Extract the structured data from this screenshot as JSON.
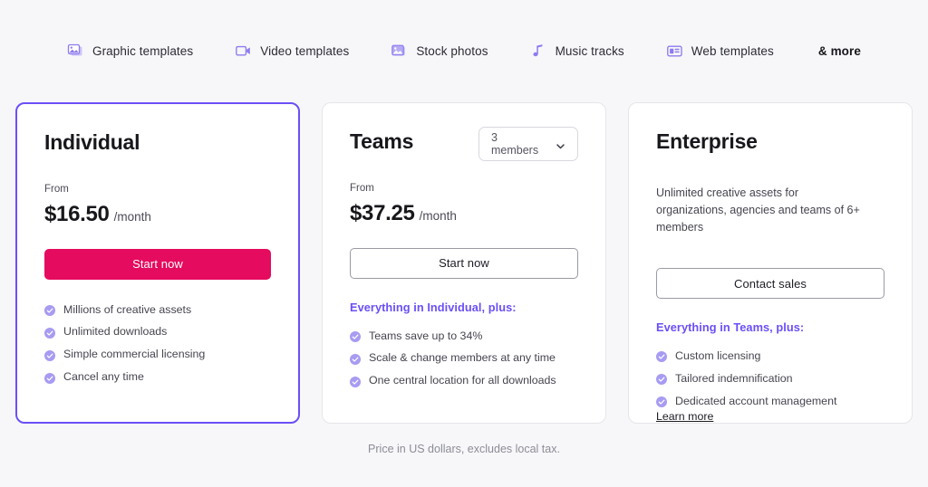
{
  "colors": {
    "page_background": "#f7f7f9",
    "accent_purple": "#6c4ff7",
    "primary_button": "#e50b5e",
    "card_background": "#ffffff",
    "check_icon": "#a79bf2"
  },
  "category_nav": {
    "items": [
      {
        "label": "Graphic templates",
        "icon": "graphic-templates-icon"
      },
      {
        "label": "Video templates",
        "icon": "video-templates-icon"
      },
      {
        "label": "Stock photos",
        "icon": "stock-photos-icon"
      },
      {
        "label": "Music tracks",
        "icon": "music-tracks-icon"
      },
      {
        "label": "Web templates",
        "icon": "web-templates-icon"
      },
      {
        "label": "& more",
        "icon": null
      }
    ]
  },
  "plans": [
    {
      "id": "individual",
      "title": "Individual",
      "featured": true,
      "from_label": "From",
      "price_amount": "$16.50",
      "price_period": "/month",
      "cta_label": "Start now",
      "cta_style": "primary",
      "features_heading": null,
      "features": [
        "Millions of creative assets",
        "Unlimited downloads",
        "Simple commercial licensing",
        "Cancel any time"
      ],
      "learn_more": null
    },
    {
      "id": "teams",
      "title": "Teams",
      "featured": false,
      "members_select_value": "3 members",
      "from_label": "From",
      "price_amount": "$37.25",
      "price_period": "/month",
      "cta_label": "Start now",
      "cta_style": "secondary",
      "features_heading": "Everything in Individual, plus:",
      "features": [
        "Teams save up to 34%",
        "Scale & change members at any time",
        "One central location for all downloads"
      ],
      "learn_more": null
    },
    {
      "id": "enterprise",
      "title": "Enterprise",
      "featured": false,
      "description": "Unlimited creative assets for organizations, agencies and teams of 6+ members",
      "cta_label": "Contact sales",
      "cta_style": "secondary",
      "features_heading": "Everything in Teams, plus:",
      "features": [
        "Custom licensing",
        "Tailored indemnification",
        "Dedicated account management"
      ],
      "learn_more": "Learn more"
    }
  ],
  "footnote": "Price in US dollars, excludes local tax."
}
